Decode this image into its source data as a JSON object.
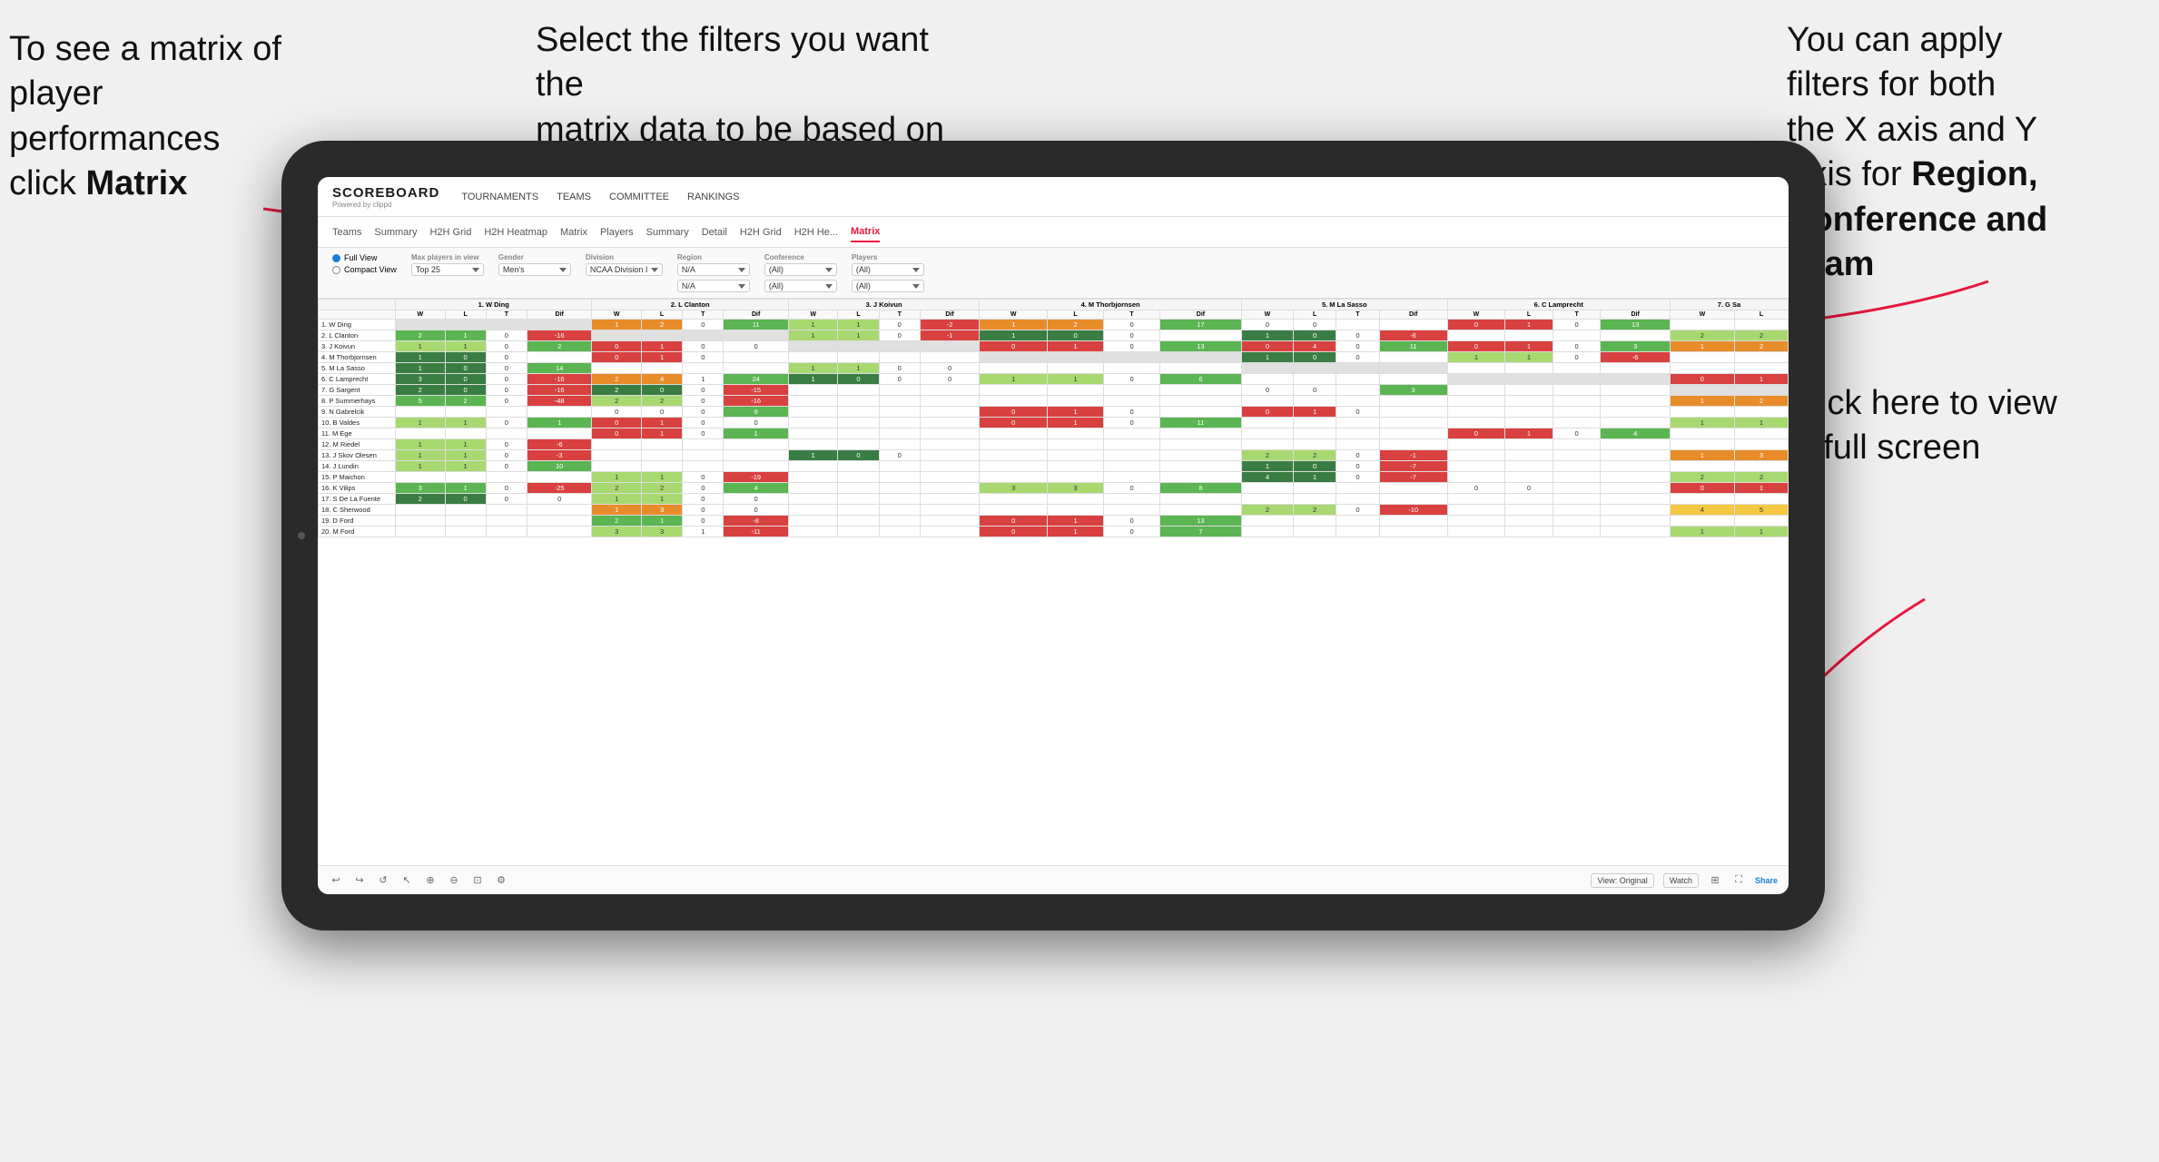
{
  "annotations": {
    "left": {
      "line1": "To see a matrix of",
      "line2": "player performances",
      "line3_prefix": "click ",
      "line3_bold": "Matrix"
    },
    "center": {
      "line1": "Select the filters you want the",
      "line2": "matrix data to be based on"
    },
    "right": {
      "line1": "You  can apply",
      "line2": "filters for both",
      "line3": "the X axis and Y",
      "line4_prefix": "Axis for ",
      "line4_bold": "Region,",
      "line5_bold": "Conference and",
      "line6_bold": "Team"
    },
    "bottom_right": {
      "line1": "Click here to view",
      "line2": "in full screen"
    }
  },
  "app": {
    "logo": "SCOREBOARD",
    "logo_sub": "Powered by clippd",
    "nav_items": [
      "TOURNAMENTS",
      "TEAMS",
      "COMMITTEE",
      "RANKINGS"
    ]
  },
  "sub_nav": {
    "items": [
      "Teams",
      "Summary",
      "H2H Grid",
      "H2H Heatmap",
      "Matrix",
      "Players",
      "Summary",
      "Detail",
      "H2H Grid",
      "H2H He...",
      "Matrix"
    ],
    "active": "Matrix"
  },
  "filters": {
    "view_options": [
      "Full View",
      "Compact View"
    ],
    "selected_view": "Full View",
    "max_players_label": "Max players in view",
    "max_players_value": "Top 25",
    "gender_label": "Gender",
    "gender_value": "Men's",
    "division_label": "Division",
    "division_value": "NCAA Division I",
    "region_label": "Region",
    "region_value": "N/A",
    "region_value2": "N/A",
    "conference_label": "Conference",
    "conference_value": "(All)",
    "conference_value2": "(All)",
    "players_label": "Players",
    "players_value": "(All)",
    "players_value2": "(All)"
  },
  "matrix": {
    "col_headers": [
      "1. W Ding",
      "2. L Clanton",
      "3. J Koivun",
      "4. M Thorbjornsen",
      "5. M La Sasso",
      "6. C Lamprecht",
      "7. G Sa"
    ],
    "sub_headers": [
      "W",
      "L",
      "T",
      "Dif"
    ],
    "rows": [
      {
        "name": "1. W Ding",
        "cells": [
          [
            null,
            null,
            null,
            null
          ],
          [
            1,
            2,
            0,
            11
          ],
          [
            1,
            1,
            0,
            -2
          ],
          [
            1,
            2,
            0,
            17
          ],
          [
            0,
            0,
            null,
            null
          ],
          [
            0,
            1,
            0,
            13
          ],
          [
            null,
            null,
            null,
            null
          ]
        ]
      },
      {
        "name": "2. L Clanton",
        "cells": [
          [
            2,
            1,
            0,
            -16
          ],
          [
            null,
            null,
            null,
            null
          ],
          [
            1,
            1,
            0,
            -1
          ],
          [
            1,
            0,
            0,
            null
          ],
          [
            1,
            0,
            0,
            -6
          ],
          [
            null,
            null,
            null,
            null
          ],
          [
            2,
            2,
            null,
            null
          ]
        ]
      },
      {
        "name": "3. J Koivun",
        "cells": [
          [
            1,
            1,
            0,
            2
          ],
          [
            0,
            1,
            0,
            0
          ],
          [
            null,
            null,
            null,
            null
          ],
          [
            0,
            1,
            0,
            13
          ],
          [
            0,
            4,
            0,
            11
          ],
          [
            0,
            1,
            0,
            3
          ],
          [
            1,
            2,
            null,
            null
          ]
        ]
      },
      {
        "name": "4. M Thorbjornsen",
        "cells": [
          [
            1,
            0,
            0,
            null
          ],
          [
            0,
            1,
            0,
            null
          ],
          [
            null,
            null,
            null,
            null
          ],
          [
            null,
            null,
            null,
            null
          ],
          [
            1,
            0,
            0,
            null
          ],
          [
            1,
            1,
            0,
            -6
          ],
          [
            null,
            null,
            null,
            null
          ]
        ]
      },
      {
        "name": "5. M La Sasso",
        "cells": [
          [
            1,
            0,
            0,
            14
          ],
          [
            null,
            null,
            null,
            null
          ],
          [
            1,
            1,
            0,
            0
          ],
          [
            null,
            null,
            null,
            null
          ],
          [
            null,
            null,
            null,
            null
          ],
          [
            null,
            null,
            null,
            null
          ],
          [
            null,
            null,
            null,
            null
          ]
        ]
      },
      {
        "name": "6. C Lamprecht",
        "cells": [
          [
            3,
            0,
            0,
            -16
          ],
          [
            2,
            4,
            1,
            24
          ],
          [
            1,
            0,
            0,
            0
          ],
          [
            1,
            1,
            0,
            6
          ],
          [
            null,
            null,
            null,
            null
          ],
          [
            null,
            null,
            null,
            null
          ],
          [
            0,
            1,
            null,
            null
          ]
        ]
      },
      {
        "name": "7. G Sargent",
        "cells": [
          [
            2,
            0,
            0,
            -16
          ],
          [
            2,
            0,
            0,
            -15
          ],
          [
            null,
            null,
            null,
            null
          ],
          [
            null,
            null,
            null,
            null
          ],
          [
            0,
            0,
            null,
            3
          ],
          [
            null,
            null,
            null,
            null
          ],
          [
            null,
            null,
            null,
            null
          ]
        ]
      },
      {
        "name": "8. P Summerhays",
        "cells": [
          [
            5,
            2,
            0,
            -48
          ],
          [
            2,
            2,
            0,
            -16
          ],
          [
            null,
            null,
            null,
            null
          ],
          [
            null,
            null,
            null,
            null
          ],
          [
            null,
            null,
            null,
            null
          ],
          [
            null,
            null,
            null,
            null
          ],
          [
            1,
            2,
            null,
            null
          ]
        ]
      },
      {
        "name": "9. N Gabrelcik",
        "cells": [
          [
            null,
            null,
            null,
            null
          ],
          [
            0,
            0,
            0,
            9
          ],
          [
            null,
            null,
            null,
            null
          ],
          [
            0,
            1,
            0,
            null
          ],
          [
            0,
            1,
            0,
            null
          ],
          [
            null,
            null,
            null,
            null
          ],
          [
            null,
            null,
            null,
            null
          ]
        ]
      },
      {
        "name": "10. B Valdes",
        "cells": [
          [
            1,
            1,
            0,
            1
          ],
          [
            0,
            1,
            0,
            0
          ],
          [
            null,
            null,
            null,
            null
          ],
          [
            0,
            1,
            0,
            11
          ],
          [
            null,
            null,
            null,
            null
          ],
          [
            null,
            null,
            null,
            null
          ],
          [
            1,
            1,
            null,
            null
          ]
        ]
      },
      {
        "name": "11. M Ege",
        "cells": [
          [
            null,
            null,
            null,
            null
          ],
          [
            0,
            1,
            0,
            1
          ],
          [
            null,
            null,
            null,
            null
          ],
          [
            null,
            null,
            null,
            null
          ],
          [
            null,
            null,
            null,
            null
          ],
          [
            0,
            1,
            0,
            4
          ],
          [
            null,
            null,
            null,
            null
          ]
        ]
      },
      {
        "name": "12. M Riedel",
        "cells": [
          [
            1,
            1,
            0,
            -6
          ],
          [
            null,
            null,
            null,
            null
          ],
          [
            null,
            null,
            null,
            null
          ],
          [
            null,
            null,
            null,
            null
          ],
          [
            null,
            null,
            null,
            null
          ],
          [
            null,
            null,
            null,
            null
          ],
          [
            null,
            null,
            null,
            null
          ]
        ]
      },
      {
        "name": "13. J Skov Olesen",
        "cells": [
          [
            1,
            1,
            0,
            -3
          ],
          [
            null,
            null,
            null,
            null
          ],
          [
            1,
            0,
            0,
            null
          ],
          [
            null,
            null,
            null,
            null
          ],
          [
            2,
            2,
            0,
            -1
          ],
          [
            null,
            null,
            null,
            null
          ],
          [
            1,
            3,
            null,
            null
          ]
        ]
      },
      {
        "name": "14. J Lundin",
        "cells": [
          [
            1,
            1,
            0,
            10
          ],
          [
            null,
            null,
            null,
            null
          ],
          [
            null,
            null,
            null,
            null
          ],
          [
            null,
            null,
            null,
            null
          ],
          [
            1,
            0,
            0,
            -7
          ],
          [
            null,
            null,
            null,
            null
          ],
          [
            null,
            null,
            null,
            null
          ]
        ]
      },
      {
        "name": "15. P Maichon",
        "cells": [
          [
            null,
            null,
            null,
            null
          ],
          [
            1,
            1,
            0,
            -19
          ],
          [
            null,
            null,
            null,
            null
          ],
          [
            null,
            null,
            null,
            null
          ],
          [
            4,
            1,
            0,
            -7
          ],
          [
            null,
            null,
            null,
            null
          ],
          [
            2,
            2,
            null,
            null
          ]
        ]
      },
      {
        "name": "16. K Vilips",
        "cells": [
          [
            3,
            1,
            0,
            -25
          ],
          [
            2,
            2,
            0,
            4
          ],
          [
            null,
            null,
            null,
            null
          ],
          [
            3,
            3,
            0,
            8
          ],
          [
            null,
            null,
            null,
            null
          ],
          [
            0,
            0,
            null,
            null
          ],
          [
            0,
            1,
            null,
            null
          ]
        ]
      },
      {
        "name": "17. S De La Fuente",
        "cells": [
          [
            2,
            0,
            0,
            0
          ],
          [
            1,
            1,
            0,
            0
          ],
          [
            null,
            null,
            null,
            null
          ],
          [
            null,
            null,
            null,
            null
          ],
          [
            null,
            null,
            null,
            null
          ],
          [
            null,
            null,
            null,
            null
          ],
          [
            null,
            null,
            null,
            null
          ]
        ]
      },
      {
        "name": "18. C Sherwood",
        "cells": [
          [
            null,
            null,
            null,
            null
          ],
          [
            1,
            3,
            0,
            0
          ],
          [
            null,
            null,
            null,
            null
          ],
          [
            null,
            null,
            null,
            null
          ],
          [
            2,
            2,
            0,
            -10
          ],
          [
            null,
            null,
            null,
            null
          ],
          [
            4,
            5,
            null,
            null
          ]
        ]
      },
      {
        "name": "19. D Ford",
        "cells": [
          [
            null,
            null,
            null,
            null
          ],
          [
            2,
            1,
            0,
            -8
          ],
          [
            null,
            null,
            null,
            null
          ],
          [
            0,
            1,
            0,
            13
          ],
          [
            null,
            null,
            null,
            null
          ],
          [
            null,
            null,
            null,
            null
          ],
          [
            null,
            null,
            null,
            null
          ]
        ]
      },
      {
        "name": "20. M Ford",
        "cells": [
          [
            null,
            null,
            null,
            null
          ],
          [
            3,
            3,
            1,
            -11
          ],
          [
            null,
            null,
            null,
            null
          ],
          [
            0,
            1,
            0,
            7
          ],
          [
            null,
            null,
            null,
            null
          ],
          [
            null,
            null,
            null,
            null
          ],
          [
            1,
            1,
            null,
            null
          ]
        ]
      }
    ]
  },
  "toolbar": {
    "view_original": "View: Original",
    "watch": "Watch",
    "share": "Share"
  }
}
